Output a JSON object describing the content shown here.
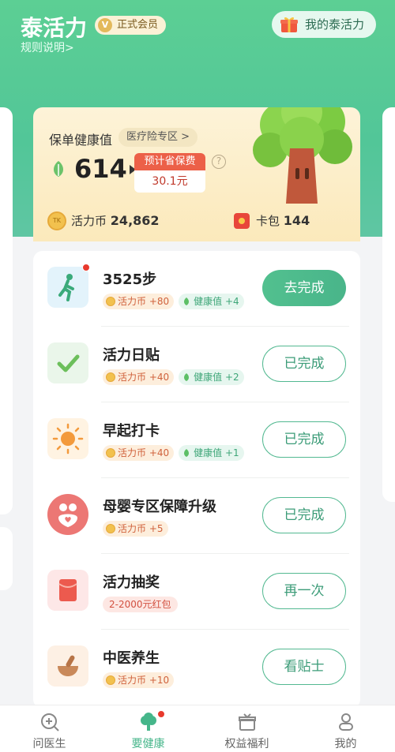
{
  "header": {
    "title": "泰活力",
    "member_badge": "正式会员",
    "rules_link": "规则说明>",
    "my_button": "我的泰活力"
  },
  "health_card": {
    "title": "保单健康值",
    "zone_link": "医疗险专区 >",
    "value": "614",
    "save_label": "预计省保费",
    "save_value": "30.1元",
    "coins_label": "活力币",
    "coins_value": "24,862",
    "wallet_label": "卡包",
    "wallet_value": "144"
  },
  "tasks": [
    {
      "title": "3525步",
      "coin_tag": "活力币 +80",
      "health_tag": "健康值 +4",
      "action": "去完成",
      "icon": "walking-person-icon",
      "badge": true
    },
    {
      "title": "活力日贴",
      "coin_tag": "活力币 +40",
      "health_tag": "健康值 +2",
      "action": "已完成",
      "icon": "checkmark-icon"
    },
    {
      "title": "早起打卡",
      "coin_tag": "活力币 +40",
      "health_tag": "健康值 +1",
      "action": "已完成",
      "icon": "sun-icon"
    },
    {
      "title": "母婴专区保障升级",
      "coin_tag": "活力币 +5",
      "action": "已完成",
      "icon": "mother-baby-icon"
    },
    {
      "title": "活力抽奖",
      "red_tag": "2-2000元红包",
      "action": "再一次",
      "icon": "red-envelope-icon"
    },
    {
      "title": "中医养生",
      "coin_tag": "活力币 +10",
      "action": "看贴士",
      "icon": "mortar-bowl-icon"
    }
  ],
  "tabbar": [
    {
      "label": "问医生",
      "icon": "doctor-search-icon"
    },
    {
      "label": "要健康",
      "icon": "health-tree-icon",
      "active": true
    },
    {
      "label": "权益福利",
      "icon": "gift-box-icon"
    },
    {
      "label": "我的",
      "icon": "person-icon"
    }
  ],
  "colors": {
    "brand_green": "#52c698",
    "accent_red": "#ec6048"
  }
}
